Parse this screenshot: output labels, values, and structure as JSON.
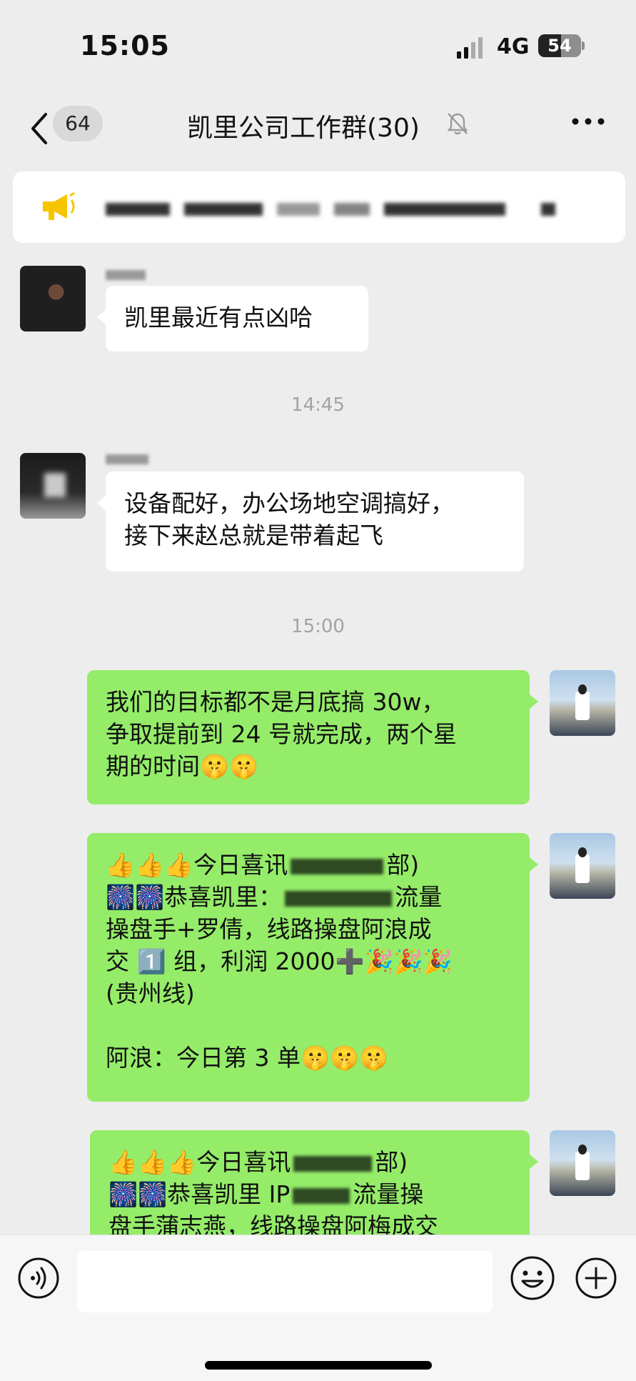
{
  "status_bar": {
    "time": "15:05",
    "network": "4G",
    "battery": "54",
    "battery_level": 0.54
  },
  "nav": {
    "unread_count": "64",
    "title": "凯里公司工作群(30)"
  },
  "messages": {
    "m1": {
      "text": "凯里最近有点凶哈"
    },
    "t1": "14:45",
    "m2": {
      "text": "设备配好，办公场地空调搞好，\n接下来赵总就是带着起飞"
    },
    "t2": "15:00",
    "m3": {
      "text": "我们的目标都不是月底搞 30w，\n争取提前到 24 号就完成，两个星\n期的时间🤫🤫"
    },
    "m4": {
      "l1_pre": "👍👍👍今日喜讯",
      "l1_post": "部)",
      "l2_pre": "🎆🎆恭喜凯里：",
      "l2_post": "流量",
      "l3": "操盘手+罗倩，线路操盘阿浪成",
      "l4": "交 1️⃣ 组，利润 2000➕🎉🎉🎉",
      "l5": "(贵州线)",
      "l7": "阿浪：今日第 3 单🤫🤫🤫"
    },
    "m5": {
      "l1_pre": "👍👍👍今日喜讯",
      "l1_post": "部)",
      "l2_pre": "🎆🎆恭喜凯里 IP",
      "l2_post": "流量操",
      "l3": "盘手蒲志燕，线路操盘阿梅成交"
    }
  },
  "input": {
    "placeholder": ""
  }
}
